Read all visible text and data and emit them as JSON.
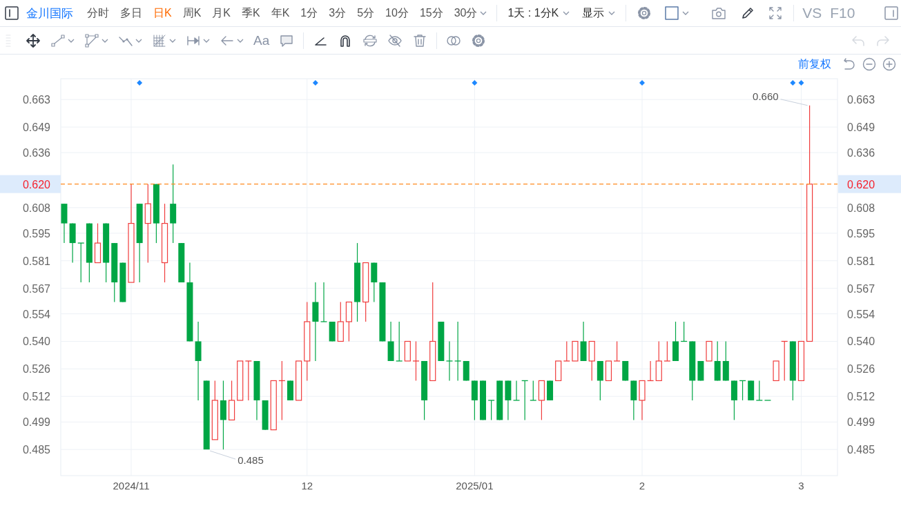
{
  "stock_name": "金川国际",
  "periods": [
    {
      "label": "分时",
      "selected": false,
      "kind": "tab"
    },
    {
      "label": "多日",
      "selected": false,
      "kind": "tab"
    },
    {
      "label": "日K",
      "selected": true,
      "kind": "tab"
    },
    {
      "label": "周K",
      "selected": false,
      "kind": "tab"
    },
    {
      "label": "月K",
      "selected": false,
      "kind": "tab"
    },
    {
      "label": "季K",
      "selected": false,
      "kind": "tab"
    },
    {
      "label": "年K",
      "selected": false,
      "kind": "tab"
    },
    {
      "label": "1分",
      "selected": false,
      "kind": "tab"
    },
    {
      "label": "3分",
      "selected": false,
      "kind": "tab"
    },
    {
      "label": "5分",
      "selected": false,
      "kind": "tab"
    },
    {
      "label": "10分",
      "selected": false,
      "kind": "tab"
    },
    {
      "label": "15分",
      "selected": false,
      "kind": "tab"
    },
    {
      "label": "30分",
      "selected": false,
      "kind": "dropdown"
    }
  ],
  "menus": [
    {
      "label": "1天 : 1分K"
    },
    {
      "label": "显示"
    }
  ],
  "text_buttons": [
    "VS",
    "F10"
  ],
  "text_tool": "Aa",
  "undo": {
    "disabled": true
  },
  "redo": {
    "disabled": true
  },
  "chart": {
    "adjust_label": "前复权",
    "chart_data": {
      "type": "candlestick",
      "grid": true,
      "ylim": [
        0.4717,
        0.6736
      ],
      "categories": [
        null,
        null,
        null,
        null,
        null,
        null,
        null,
        null,
        "2024/11",
        null,
        null,
        null,
        null,
        null,
        null,
        null,
        null,
        null,
        null,
        null,
        null,
        null,
        null,
        null,
        null,
        null,
        null,
        null,
        null,
        "12",
        null,
        null,
        null,
        null,
        null,
        null,
        null,
        null,
        null,
        null,
        null,
        null,
        null,
        null,
        null,
        null,
        null,
        null,
        null,
        "2025/01",
        null,
        null,
        null,
        null,
        null,
        null,
        null,
        null,
        null,
        null,
        null,
        null,
        null,
        null,
        null,
        null,
        null,
        null,
        null,
        "2",
        null,
        null,
        null,
        null,
        null,
        null,
        null,
        null,
        null,
        null,
        null,
        null,
        null,
        null,
        null,
        null,
        null,
        null,
        "3",
        null
      ],
      "ohlc": [
        [
          0.61,
          0.61,
          0.59,
          0.6
        ],
        [
          0.6,
          0.6,
          0.58,
          0.59
        ],
        [
          0.59,
          0.59,
          0.57,
          0.59
        ],
        [
          0.6,
          0.6,
          0.57,
          0.58
        ],
        [
          0.58,
          0.6,
          0.58,
          0.59
        ],
        [
          0.6,
          0.6,
          0.57,
          0.58
        ],
        [
          0.59,
          0.59,
          0.56,
          0.57
        ],
        [
          0.58,
          0.58,
          0.56,
          0.56
        ],
        [
          0.57,
          0.62,
          0.57,
          0.6
        ],
        [
          0.61,
          0.61,
          0.57,
          0.59
        ],
        [
          0.6,
          0.62,
          0.58,
          0.61
        ],
        [
          0.62,
          0.62,
          0.59,
          0.6
        ],
        [
          0.58,
          0.61,
          0.57,
          0.6
        ],
        [
          0.61,
          0.63,
          0.59,
          0.6
        ],
        [
          0.59,
          0.59,
          0.57,
          0.57
        ],
        [
          0.57,
          0.58,
          0.54,
          0.54
        ],
        [
          0.54,
          0.55,
          0.51,
          0.53
        ],
        [
          0.52,
          0.52,
          0.485,
          0.485
        ],
        [
          0.49,
          0.52,
          0.49,
          0.51
        ],
        [
          0.51,
          0.52,
          0.485,
          0.5
        ],
        [
          0.5,
          0.52,
          0.5,
          0.51
        ],
        [
          0.51,
          0.53,
          0.51,
          0.53
        ],
        [
          0.53,
          0.53,
          0.51,
          0.53
        ],
        [
          0.53,
          0.53,
          0.5,
          0.51
        ],
        [
          0.51,
          0.51,
          0.495,
          0.495
        ],
        [
          0.495,
          0.52,
          0.495,
          0.52
        ],
        [
          0.52,
          0.53,
          0.5,
          0.52
        ],
        [
          0.52,
          0.52,
          0.51,
          0.51
        ],
        [
          0.51,
          0.53,
          0.51,
          0.53
        ],
        [
          0.53,
          0.56,
          0.52,
          0.55
        ],
        [
          0.56,
          0.57,
          0.53,
          0.55
        ],
        [
          0.55,
          0.57,
          0.55,
          0.55
        ],
        [
          0.55,
          0.55,
          0.54,
          0.54
        ],
        [
          0.54,
          0.56,
          0.54,
          0.55
        ],
        [
          0.55,
          0.56,
          0.54,
          0.56
        ],
        [
          0.58,
          0.59,
          0.55,
          0.56
        ],
        [
          0.56,
          0.58,
          0.55,
          0.58
        ],
        [
          0.58,
          0.58,
          0.56,
          0.57
        ],
        [
          0.57,
          0.57,
          0.54,
          0.54
        ],
        [
          0.54,
          0.55,
          0.53,
          0.53
        ],
        [
          0.53,
          0.55,
          0.53,
          0.53
        ],
        [
          0.53,
          0.54,
          0.53,
          0.54
        ],
        [
          0.53,
          0.54,
          0.52,
          0.53
        ],
        [
          0.53,
          0.53,
          0.5,
          0.51
        ],
        [
          0.52,
          0.57,
          0.52,
          0.54
        ],
        [
          0.55,
          0.55,
          0.53,
          0.53
        ],
        [
          0.53,
          0.54,
          0.52,
          0.53
        ],
        [
          0.53,
          0.55,
          0.52,
          0.53
        ],
        [
          0.53,
          0.53,
          0.52,
          0.52
        ],
        [
          0.52,
          0.52,
          0.5,
          0.51
        ],
        [
          0.52,
          0.52,
          0.5,
          0.5
        ],
        [
          0.51,
          0.51,
          0.5,
          0.51
        ],
        [
          0.52,
          0.52,
          0.5,
          0.5
        ],
        [
          0.52,
          0.52,
          0.5,
          0.51
        ],
        [
          0.51,
          0.52,
          0.51,
          0.51
        ],
        [
          0.52,
          0.52,
          0.5,
          0.52
        ],
        [
          0.51,
          0.52,
          0.51,
          0.51
        ],
        [
          0.51,
          0.52,
          0.5,
          0.52
        ],
        [
          0.52,
          0.52,
          0.51,
          0.51
        ],
        [
          0.52,
          0.53,
          0.52,
          0.53
        ],
        [
          0.53,
          0.54,
          0.53,
          0.53
        ],
        [
          0.53,
          0.54,
          0.53,
          0.54
        ],
        [
          0.54,
          0.55,
          0.53,
          0.53
        ],
        [
          0.53,
          0.54,
          0.52,
          0.54
        ],
        [
          0.53,
          0.53,
          0.51,
          0.52
        ],
        [
          0.52,
          0.53,
          0.52,
          0.53
        ],
        [
          0.53,
          0.54,
          0.53,
          0.53
        ],
        [
          0.53,
          0.53,
          0.52,
          0.52
        ],
        [
          0.52,
          0.52,
          0.5,
          0.51
        ],
        [
          0.51,
          0.52,
          0.5,
          0.52
        ],
        [
          0.52,
          0.53,
          0.52,
          0.52
        ],
        [
          0.52,
          0.54,
          0.52,
          0.53
        ],
        [
          0.53,
          0.54,
          0.53,
          0.53
        ],
        [
          0.54,
          0.55,
          0.53,
          0.53
        ],
        [
          0.54,
          0.55,
          0.54,
          0.54
        ],
        [
          0.54,
          0.54,
          0.51,
          0.52
        ],
        [
          0.53,
          0.53,
          0.52,
          0.52
        ],
        [
          0.53,
          0.54,
          0.53,
          0.54
        ],
        [
          0.53,
          0.54,
          0.52,
          0.52
        ],
        [
          0.53,
          0.54,
          0.52,
          0.52
        ],
        [
          0.52,
          0.52,
          0.5,
          0.51
        ],
        [
          0.52,
          0.52,
          0.51,
          0.52
        ],
        [
          0.52,
          0.52,
          0.51,
          0.51
        ],
        [
          0.51,
          0.52,
          0.51,
          0.51
        ],
        [
          0.51,
          0.51,
          0.51,
          0.51
        ],
        [
          0.52,
          0.53,
          0.52,
          0.53
        ],
        [
          0.54,
          0.54,
          0.52,
          0.54
        ],
        [
          0.54,
          0.54,
          0.51,
          0.52
        ],
        [
          0.52,
          0.54,
          0.52,
          0.54
        ],
        [
          0.54,
          0.66,
          0.54,
          0.62
        ]
      ],
      "yticks": [
        {
          "value": 0.663,
          "label": "0.663"
        },
        {
          "value": 0.649,
          "label": "0.649"
        },
        {
          "value": 0.636,
          "label": "0.636"
        },
        {
          "value": 0.608,
          "label": "0.608"
        },
        {
          "value": 0.595,
          "label": "0.595"
        },
        {
          "value": 0.581,
          "label": "0.581"
        },
        {
          "value": 0.567,
          "label": "0.567"
        },
        {
          "value": 0.554,
          "label": "0.554"
        },
        {
          "value": 0.54,
          "label": "0.540"
        },
        {
          "value": 0.526,
          "label": "0.526"
        },
        {
          "value": 0.512,
          "label": "0.512"
        },
        {
          "value": 0.499,
          "label": "0.499"
        },
        {
          "value": 0.485,
          "label": "0.485"
        }
      ],
      "ref_lines": [
        {
          "axis": "y",
          "value": 0.62,
          "label": "0.620"
        }
      ],
      "annotations": [
        "0.660",
        "0.485"
      ]
    }
  }
}
